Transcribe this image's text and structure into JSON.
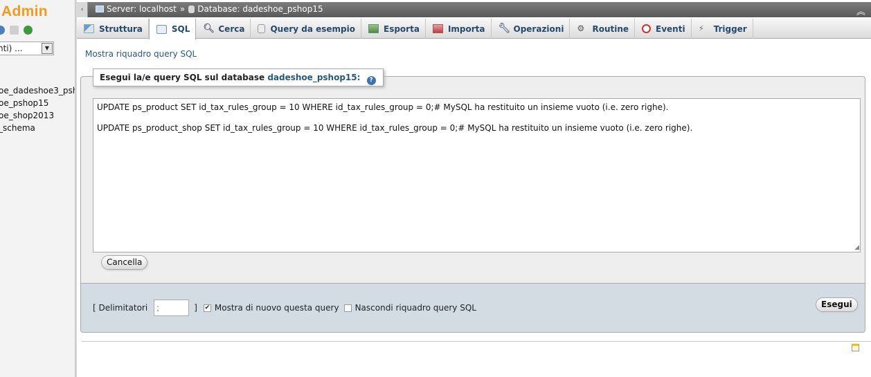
{
  "nav": {
    "logo": "Admin",
    "select_value": "nti) ...",
    "databases": [
      "oe_dadeshoe3_psh",
      "oe_pshop15",
      "oe_shop2013",
      "_schema"
    ]
  },
  "breadcrumb": {
    "server": "Server: localhost",
    "sep": "»",
    "database": "Database: dadeshoe_pshop15"
  },
  "tabs": [
    {
      "label": "Struttura",
      "icon": "structure-icon"
    },
    {
      "label": "SQL",
      "icon": "sql-icon"
    },
    {
      "label": "Cerca",
      "icon": "search-icon"
    },
    {
      "label": "Query da esempio",
      "icon": "query-icon"
    },
    {
      "label": "Esporta",
      "icon": "export-icon"
    },
    {
      "label": "Importa",
      "icon": "import-icon"
    },
    {
      "label": "Operazioni",
      "icon": "wrench-icon"
    },
    {
      "label": "Routine",
      "icon": "routine-icon"
    },
    {
      "label": "Eventi",
      "icon": "clock-icon"
    },
    {
      "label": "Trigger",
      "icon": "trigger-icon"
    }
  ],
  "active_tab": "SQL",
  "main": {
    "show_query_link": "Mostra riquadro query SQL",
    "legend_prefix": "Esegui la/e query SQL sul database",
    "legend_db": "dadeshoe_pshop15:",
    "sql_lines": [
      "UPDATE ps_product SET id_tax_rules_group = 10 WHERE id_tax_rules_group = 0;# MySQL ha restituito un insieme vuoto (i.e. zero righe).",
      "UPDATE ps_product_shop SET id_tax_rules_group = 10 WHERE id_tax_rules_group = 0;# MySQL ha restituito un insieme vuoto (i.e. zero righe)."
    ],
    "cancel_label": "Cancella",
    "delimiter_label_open": "[ Delimitatori",
    "delimiter_value": ";",
    "delimiter_label_close": "]",
    "show_again_label": "Mostra di nuovo questa query",
    "show_again_checked": true,
    "hide_box_label": "Nascondi riquadro query SQL",
    "hide_box_checked": false,
    "go_label": "Esegui"
  },
  "colors": {
    "logo": "#f39b1c",
    "link": "#235a81",
    "options_bg": "#d3dce3",
    "fieldset_bg": "#eeeeee"
  }
}
